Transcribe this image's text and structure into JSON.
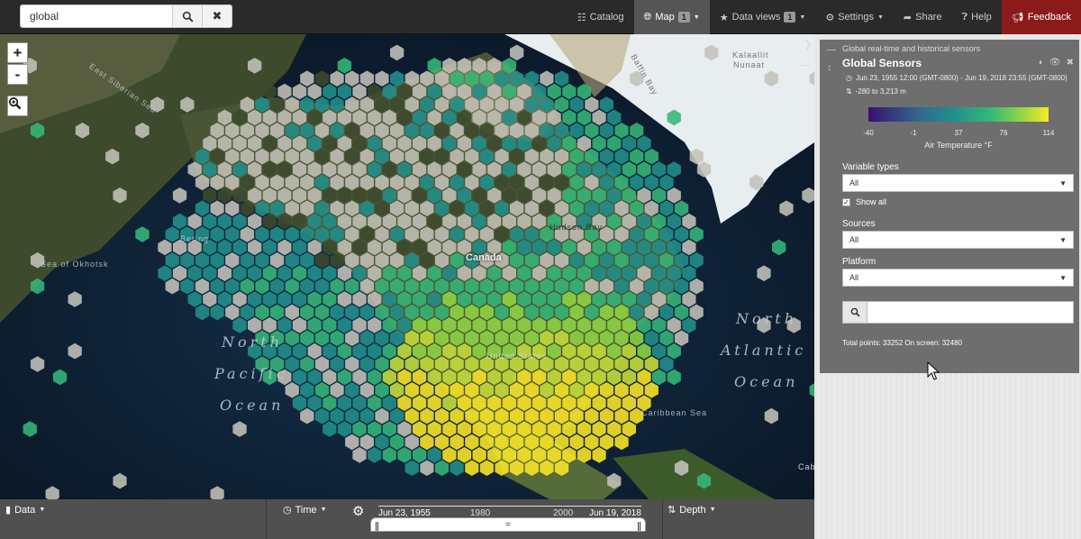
{
  "navbar": {
    "search_value": "global",
    "search_button_icon": "search-icon",
    "clear_button_icon": "close-icon",
    "items": [
      {
        "label": "Catalog",
        "icon": "list-icon"
      },
      {
        "label": "Map",
        "icon": "globe-icon",
        "badge": "1"
      },
      {
        "label": "Data views",
        "icon": "star-icon",
        "badge": "1"
      },
      {
        "label": "Settings",
        "icon": "gear-icon"
      },
      {
        "label": "Share",
        "icon": "share-icon"
      },
      {
        "label": "Help",
        "icon": "help-icon"
      },
      {
        "label": "Feedback",
        "icon": "bullhorn-icon"
      }
    ]
  },
  "map": {
    "zoom_in": "+",
    "zoom_out": "-",
    "labels": {
      "canada": "Canada",
      "north_pacific_1": "North",
      "north_pacific_2": "Pacific",
      "north_pacific_3": "Ocean",
      "north_atlantic_1": "North",
      "north_atlantic_2": "Atlantic",
      "north_atlantic_3": "Ocean",
      "kalaallit_1": "Kalaallit",
      "kalaallit_2": "Nunaat",
      "east_siberian": "East Siberian Sea",
      "bering": "Bering",
      "okhotsk": "Sea of Okhotsk",
      "hudson_bay": "Hudson Bay",
      "baffin_bay": "Baffin Bay",
      "united_states": "United States",
      "caribbean": "Caribbean Sea",
      "cabo": "Cabo"
    }
  },
  "panel": {
    "subtitle": "Global real-time and historical sensors",
    "title": "Global Sensors",
    "date_range": "Jun 23, 1955 12:00 (GMT-0800) - Jun 19, 2018 23:55 (GMT-0800)",
    "depth_range": "-280 to 3,213 m",
    "legend": {
      "ticks": [
        "-40",
        "-1",
        "37",
        "76",
        "114"
      ],
      "label": "Air Temperature °F"
    },
    "variable_types_label": "Variable types",
    "variable_types_value": "All",
    "show_all_label": "Show all",
    "show_all_checked": true,
    "sources_label": "Sources",
    "sources_value": "All",
    "platform_label": "Platform",
    "platform_value": "All",
    "filter_placeholder": "",
    "totals": "Total points: 33252 On screen: 32480"
  },
  "bottombar": {
    "data_label": "Data",
    "time_label": "Time",
    "depth_label": "Depth",
    "timeline": {
      "start": "Jun 23, 1955",
      "tick1": "1980",
      "tick2": "2000",
      "end": "Jun 19, 2018",
      "handle_grip": "="
    }
  }
}
